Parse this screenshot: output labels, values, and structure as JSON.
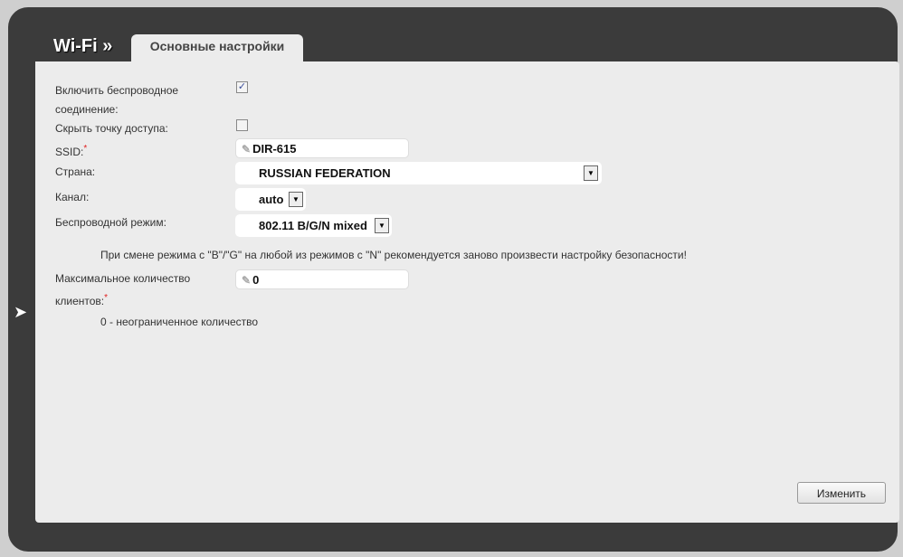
{
  "header": {
    "title": "Wi-Fi »",
    "tab": "Основные настройки"
  },
  "form": {
    "enable_label": "Включить беспроводное соединение:",
    "enable_checked": true,
    "hide_label": "Скрыть точку доступа:",
    "hide_checked": false,
    "ssid_label": "SSID:",
    "ssid_value": "DIR-615",
    "country_label": "Страна:",
    "country_value": "RUSSIAN FEDERATION",
    "channel_label": "Канал:",
    "channel_value": "auto",
    "mode_label": "Беспроводной режим:",
    "mode_value": "802.11 B/G/N mixed",
    "mode_note": "При смене режима с \"B\"/\"G\" на любой из режимов с \"N\" рекомендуется заново произвести настройку безопасности!",
    "max_clients_label": "Максимальное количество клиентов:",
    "max_clients_value": "0",
    "max_clients_note": "0 - неограниченное количество",
    "required_mark": "*",
    "check_mark": "✓"
  },
  "actions": {
    "apply": "Изменить"
  }
}
